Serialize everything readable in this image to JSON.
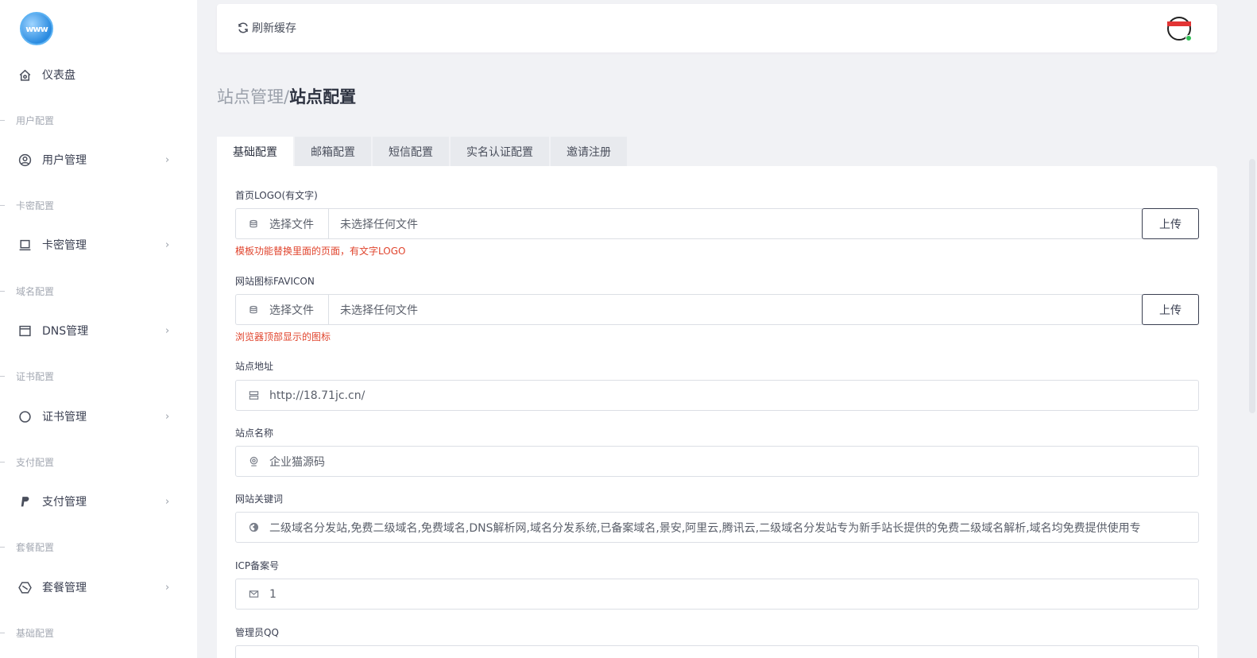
{
  "logo": {
    "text": "www"
  },
  "sidebar": {
    "items": [
      {
        "kind": "item",
        "label": "仪表盘",
        "icon": "home-icon"
      },
      {
        "kind": "section",
        "label": "用户配置"
      },
      {
        "kind": "item",
        "label": "用户管理",
        "icon": "user-circle-icon",
        "chevron": "›"
      },
      {
        "kind": "section",
        "label": "卡密配置"
      },
      {
        "kind": "item",
        "label": "卡密管理",
        "icon": "laptop-icon",
        "chevron": "›"
      },
      {
        "kind": "section",
        "label": "域名配置"
      },
      {
        "kind": "item",
        "label": "DNS管理",
        "icon": "window-icon",
        "chevron": "›"
      },
      {
        "kind": "section",
        "label": "证书配置"
      },
      {
        "kind": "item",
        "label": "证书管理",
        "icon": "circle-icon",
        "chevron": "›"
      },
      {
        "kind": "section",
        "label": "支付配置"
      },
      {
        "kind": "item",
        "label": "支付管理",
        "icon": "paypal-icon",
        "chevron": "›"
      },
      {
        "kind": "section",
        "label": "套餐配置"
      },
      {
        "kind": "item",
        "label": "套餐管理",
        "icon": "hexagon-icon",
        "chevron": "›"
      },
      {
        "kind": "section",
        "label": "基础配置"
      }
    ]
  },
  "topbar": {
    "refresh_label": "刷新缓存"
  },
  "breadcrumb": {
    "parent": "站点管理/",
    "current": "站点配置"
  },
  "tabs": [
    {
      "label": "基础配置",
      "active": true
    },
    {
      "label": "邮箱配置",
      "active": false
    },
    {
      "label": "短信配置",
      "active": false
    },
    {
      "label": "实名认证配置",
      "active": false
    },
    {
      "label": "邀请注册",
      "active": false
    }
  ],
  "form": {
    "logo": {
      "label": "首页LOGO(有文字)",
      "choose_label": "选择文件",
      "file_name": "未选择任何文件",
      "upload_label": "上传",
      "help": "模板功能替换里面的页面，有文字LOGO"
    },
    "favicon": {
      "label": "网站图标FAVICON",
      "choose_label": "选择文件",
      "file_name": "未选择任何文件",
      "upload_label": "上传",
      "help": "浏览器顶部显示的图标"
    },
    "site_url": {
      "label": "站点地址",
      "value": "http://18.71jc.cn/",
      "icon": "server-icon"
    },
    "site_name": {
      "label": "站点名称",
      "value": "企业猫源码",
      "icon": "webcam-icon"
    },
    "keywords": {
      "label": "网站关键词",
      "value": "二级域名分发站,免费二级域名,免费域名,DNS解析网,域名分发系统,已备案域名,景安,阿里云,腾讯云,二级域名分发站专为新手站长提供的免费二级域名解析,域名均免费提供使用专",
      "icon": "globe-icon"
    },
    "icp": {
      "label": "ICP备案号",
      "value": "1",
      "icon": "mail-icon"
    },
    "admin_qq": {
      "label": "管理员QQ"
    }
  }
}
